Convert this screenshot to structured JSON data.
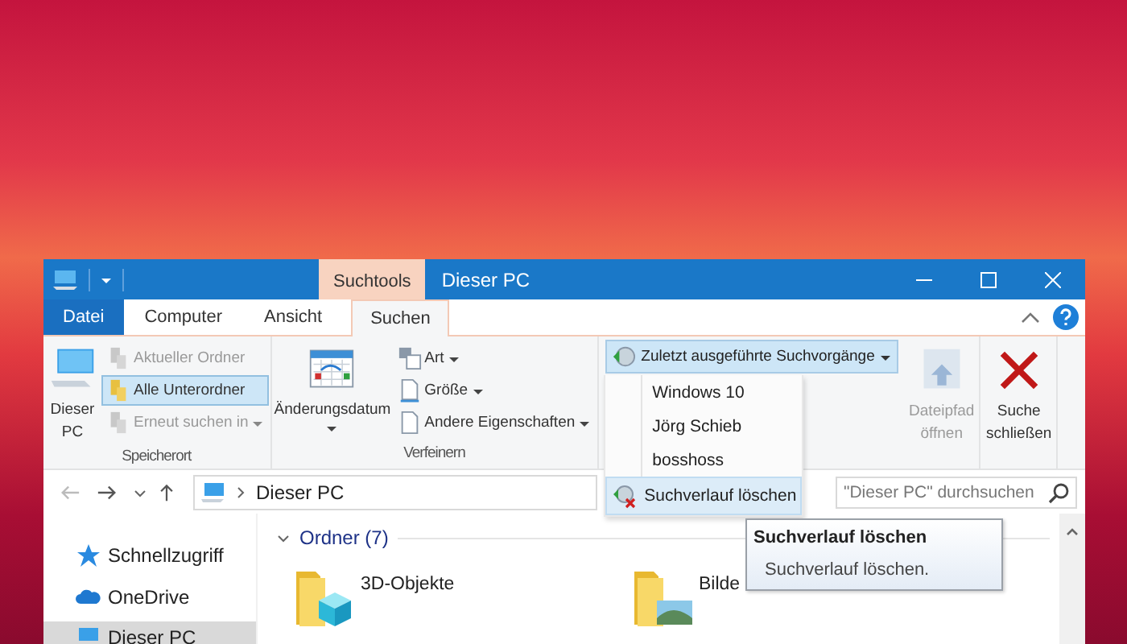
{
  "window": {
    "context_tab": "Suchtools",
    "title": "Dieser PC"
  },
  "ribbon_tabs": [
    {
      "label": "Datei",
      "kind": "file",
      "selected": false
    },
    {
      "label": "Computer",
      "kind": "tab",
      "selected": false
    },
    {
      "label": "Ansicht",
      "kind": "tab",
      "selected": false
    },
    {
      "label": "Suchen",
      "kind": "tab",
      "selected": true
    }
  ],
  "ribbon": {
    "location": {
      "label": "Speicherort",
      "big_button": [
        "Dieser",
        "PC"
      ],
      "items": [
        {
          "label": "Aktueller Ordner",
          "disabled": true,
          "selected": false,
          "dropdown": false
        },
        {
          "label": "Alle Unterordner",
          "disabled": false,
          "selected": true,
          "dropdown": false
        },
        {
          "label": "Erneut suchen in",
          "disabled": true,
          "selected": false,
          "dropdown": true
        }
      ]
    },
    "refine": {
      "label": "Verfeinern",
      "big_button": "Änderungsdatum",
      "items": [
        {
          "label": "Art",
          "kind": "type"
        },
        {
          "label": "Größe",
          "kind": "size"
        },
        {
          "label": "Andere Eigenschaften",
          "kind": "props"
        }
      ]
    },
    "recent": {
      "label": "Zuletzt ausgeführte Suchvorgänge"
    },
    "options": [
      {
        "label": [
          "Dateipfad",
          "öffnen"
        ],
        "kind": "open-path",
        "disabled": true
      },
      {
        "label": [
          "Suche",
          "schließen"
        ],
        "kind": "close-search",
        "disabled": false
      }
    ]
  },
  "recent_menu": {
    "items": [
      {
        "label": "Windows 10",
        "kind": "history",
        "selected": false
      },
      {
        "label": "Jörg Schieb",
        "kind": "history",
        "selected": false
      },
      {
        "label": "bosshoss",
        "kind": "history",
        "selected": false
      },
      {
        "label": "Suchverlauf löschen",
        "kind": "clear",
        "selected": true
      }
    ]
  },
  "address_bar": {
    "path": "Dieser PC",
    "search_placeholder": "\"Dieser PC\" durchsuchen"
  },
  "nav_pane": [
    {
      "label": "Schnellzugriff",
      "kind": "star",
      "selected": false
    },
    {
      "label": "OneDrive",
      "kind": "cloud",
      "selected": false
    },
    {
      "label": "Dieser PC",
      "kind": "pc",
      "selected": true
    }
  ],
  "content": {
    "group": "Ordner (7)",
    "folders": [
      {
        "name": "3D-Objekte",
        "kind": "cube"
      },
      {
        "name": "Bilde",
        "kind": "pictures"
      }
    ]
  },
  "tooltip": {
    "title": "Suchverlauf löschen",
    "text": "Suchverlauf löschen."
  }
}
